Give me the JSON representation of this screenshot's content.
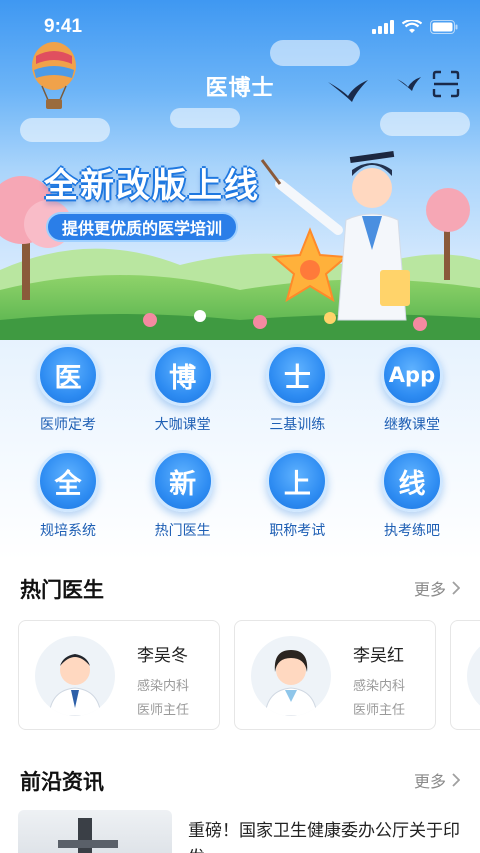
{
  "status_bar": {
    "time": "9:41"
  },
  "header": {
    "title": "医博士",
    "scan_icon": "scan-icon"
  },
  "banner": {
    "title": "全新改版上线",
    "subtitle": "提供更优质的医学培训"
  },
  "grid": [
    {
      "glyph": "医",
      "label": "医师定考"
    },
    {
      "glyph": "博",
      "label": "大咖课堂"
    },
    {
      "glyph": "士",
      "label": "三基训练"
    },
    {
      "glyph": "App",
      "label": "继教课堂"
    },
    {
      "glyph": "全",
      "label": "规培系统"
    },
    {
      "glyph": "新",
      "label": "热门医生"
    },
    {
      "glyph": "上",
      "label": "职称考试"
    },
    {
      "glyph": "线",
      "label": "执考练吧"
    }
  ],
  "hot_doctors": {
    "title": "热门医生",
    "more": "更多",
    "items": [
      {
        "name": "李吴冬",
        "dept": "感染内科",
        "role": "医师主任"
      },
      {
        "name": "李吴红",
        "dept": "感染内科",
        "role": "医师主任"
      }
    ]
  },
  "news": {
    "title": "前沿资讯",
    "more": "更多",
    "items": [
      {
        "title": "重磅！国家卫生健康委办公厅关于印发 ..."
      }
    ]
  },
  "colors": {
    "primary": "#2e8cf2",
    "label_blue": "#1e5fb4"
  }
}
